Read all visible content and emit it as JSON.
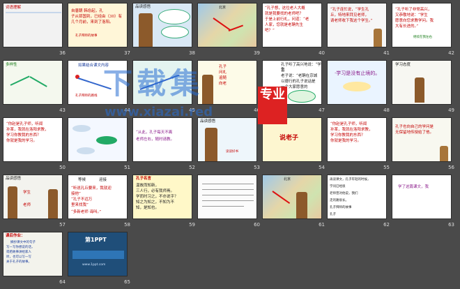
{
  "slides": [
    {
      "num": "36",
      "lines": [
        "词语理解"
      ]
    },
    {
      "num": "37",
      "lines": [
        "自唐朝 韩愈起，孔",
        "子从郯国到，已经由（30）有",
        "几个月前，来到了洛阳。",
        "孔子拜师的故事"
      ]
    },
    {
      "num": "38",
      "lines": [
        "品读感悟"
      ]
    },
    {
      "num": "39",
      "lines": [
        "北京"
      ]
    },
    {
      "num": "40",
      "lines": [
        "“孔子想，这位老人大概",
        "就是我要找的老师吧？",
        "于是上前行礼，问道：“老",
        "人家，您就是老聃先生",
        "吧？”"
      ]
    },
    {
      "num": "41",
      "lines": [
        "“孔子连忙说，“学生孔",
        "丘，特地来拜见老师，",
        "请老师收下我这个学生。”"
      ]
    },
    {
      "num": "42",
      "lines": [
        "“孔子听了非常高兴，",
        "又恭敬地说：“学生",
        "愿意向您求教学问。我",
        "大有长进的。”",
        "继续在我左右"
      ]
    },
    {
      "num": "43",
      "lines": [
        "多样性"
      ]
    },
    {
      "num": "44",
      "lines": [
        "如果结合课文内容",
        "孔子拜师的路线"
      ]
    },
    {
      "num": "45",
      "lines": []
    },
    {
      "num": "46",
      "lines": [
        "孔子",
        "问礼",
        "追随",
        "向老"
      ]
    },
    {
      "num": "47",
      "lines": [
        "孔子听了高兴地说：“学生",
        "曾",
        "老子说：“老聃在京城",
        "以德行的孔子说话是",
        "一个大家愿意的",
        "学生。”"
      ]
    },
    {
      "num": "48",
      "lines": [
        "·学习是没有止境的。"
      ]
    },
    {
      "num": "49",
      "lines": [
        "学习态度"
      ]
    },
    {
      "num": "50",
      "lines": [
        "“你赵是孔子师，听闻",
        "孙某，我就在洛阳求教，",
        "学习你教我的东西？",
        "你就是我的学习。"
      ]
    },
    {
      "num": "51",
      "lines": []
    },
    {
      "num": "52",
      "lines": [
        "“从此，孔子每天不离",
        "老师左右，随时请教。"
      ]
    },
    {
      "num": "53",
      "lines": [
        "品读感悟",
        "读读好书"
      ]
    },
    {
      "num": "54",
      "lines": [
        "说老子"
      ]
    },
    {
      "num": "55",
      "lines": [
        "“你赵是孔子师，听闻",
        "孙某，我就在洛阳求教，",
        "学习你教我的东西？",
        "你就是我的学习。"
      ]
    },
    {
      "num": "56",
      "lines": [
        "孔子也向自己的学问是",
        "无保留地传授给了他。"
      ]
    },
    {
      "num": "57",
      "lines": [
        "品读感悟",
        "学生",
        "老师"
      ]
    },
    {
      "num": "58",
      "lines": [
        "等候",
        "迎接",
        "“听说孔丘要来，我就迎",
        "接他”",
        "“孔子不远万",
        "里来找我”",
        "“多新老师 诲叫。”"
      ]
    },
    {
      "num": "59",
      "lines": [
        "孔子名言",
        "温故而知新，",
        "三人行，必有我师焉。",
        "学而时习之，不亦说乎？",
        "知之为知之，不知为不",
        "知，是知也。"
      ]
    },
    {
      "num": "60",
      "lines": []
    },
    {
      "num": "61",
      "lines": [
        "北京"
      ]
    },
    {
      "num": "62",
      "lines": [
        "再读课文，孔子年轻的时候，",
        "学问已经很",
        "老师曾对他说，我们",
        "走的路很长。",
        "孔子拜师的故事",
        "",
        "孔子"
      ]
    },
    {
      "num": "63",
      "lines": [
        "学了这篇课文，我"
      ]
    },
    {
      "num": "64",
      "lines": [
        "课后作业：",
        "摘抄课文中的句子",
        "写一写你想说的话，",
        "或把故事讲给家人",
        "听，也可以写一写",
        "关于孔子的故事。"
      ]
    },
    {
      "num": "65",
      "lines": [
        "第1PPT",
        "www.1ppt.com"
      ]
    }
  ],
  "watermark": {
    "title": "下载集",
    "stamp": "专业",
    "url": "www.xiazai.red"
  },
  "colors": {
    "background": "#4a4a4a",
    "selection": "#f4b400",
    "accent_red": "#c40000"
  }
}
